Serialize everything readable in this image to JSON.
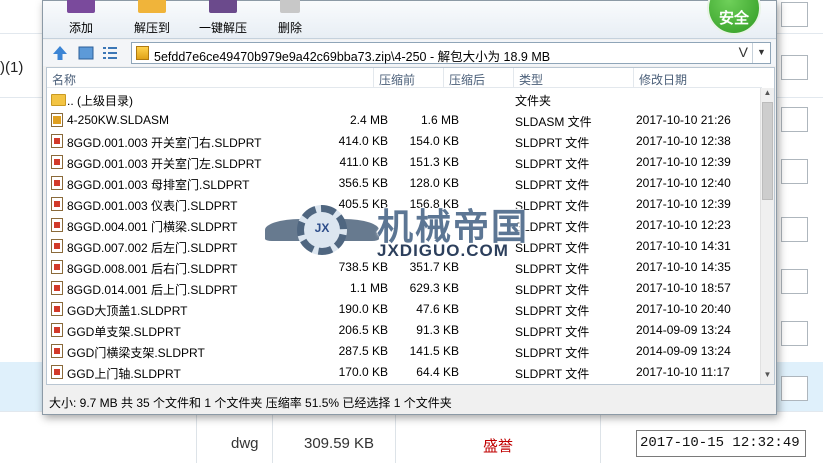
{
  "toolbar": {
    "buttons": [
      {
        "label": "添加",
        "color": "#7a4a9c"
      },
      {
        "label": "解压到",
        "color": "#f0b43a"
      },
      {
        "label": "一键解压",
        "color": "#6b4a8c"
      },
      {
        "label": "删除",
        "color": "#c8c8c8"
      }
    ],
    "badge": "安全"
  },
  "addressbar": {
    "path": "5efdd7e6ce49470b979e9a42c69bba73.zip\\4-250 - 解包大小为 18.9 MB",
    "history_glyph": "V"
  },
  "columns": {
    "name": "名称",
    "size": "压缩前",
    "packed": "压缩后",
    "type": "类型",
    "modified": "修改日期"
  },
  "files": [
    {
      "icon": "folder",
      "name": ".. (上级目录)",
      "size": "",
      "packed": "",
      "type": "文件夹",
      "modified": ""
    },
    {
      "icon": "asm",
      "name": "4-250KW.SLDASM",
      "size": "2.4 MB",
      "packed": "1.6 MB",
      "type": "SLDASM 文件",
      "modified": "2017-10-10 21:26"
    },
    {
      "icon": "doc",
      "name": "8GGD.001.003 开关室门右.SLDPRT",
      "size": "414.0 KB",
      "packed": "154.0 KB",
      "type": "SLDPRT 文件",
      "modified": "2017-10-10 12:38"
    },
    {
      "icon": "doc",
      "name": "8GGD.001.003 开关室门左.SLDPRT",
      "size": "411.0 KB",
      "packed": "151.3 KB",
      "type": "SLDPRT 文件",
      "modified": "2017-10-10 12:39"
    },
    {
      "icon": "doc",
      "name": "8GGD.001.003 母排室门.SLDPRT",
      "size": "356.5 KB",
      "packed": "128.0 KB",
      "type": "SLDPRT 文件",
      "modified": "2017-10-10 12:40"
    },
    {
      "icon": "doc",
      "name": "8GGD.001.003 仪表门.SLDPRT",
      "size": "405.5 KB",
      "packed": "156.8 KB",
      "type": "SLDPRT 文件",
      "modified": "2017-10-10 12:39"
    },
    {
      "icon": "doc",
      "name": "8GGD.004.001 门横梁.SLDPRT",
      "size": "",
      "packed": "",
      "type": "SLDPRT 文件",
      "modified": "2017-10-10 12:23"
    },
    {
      "icon": "doc",
      "name": "8GGD.007.002 后左门.SLDPRT",
      "size": "",
      "packed": "",
      "type": "SLDPRT 文件",
      "modified": "2017-10-10 14:31"
    },
    {
      "icon": "doc",
      "name": "8GGD.008.001 后右门.SLDPRT",
      "size": "738.5 KB",
      "packed": "351.7 KB",
      "type": "SLDPRT 文件",
      "modified": "2017-10-10 14:35"
    },
    {
      "icon": "doc",
      "name": "8GGD.014.001 后上门.SLDPRT",
      "size": "1.1 MB",
      "packed": "629.3 KB",
      "type": "SLDPRT 文件",
      "modified": "2017-10-10 18:57"
    },
    {
      "icon": "doc",
      "name": "GGD大顶盖1.SLDPRT",
      "size": "190.0 KB",
      "packed": "47.6 KB",
      "type": "SLDPRT 文件",
      "modified": "2017-10-10 20:40"
    },
    {
      "icon": "doc",
      "name": "GGD单支架.SLDPRT",
      "size": "206.5 KB",
      "packed": "91.3 KB",
      "type": "SLDPRT 文件",
      "modified": "2014-09-09 13:24"
    },
    {
      "icon": "doc",
      "name": "GGD门横梁支架.SLDPRT",
      "size": "287.5 KB",
      "packed": "141.5 KB",
      "type": "SLDPRT 文件",
      "modified": "2014-09-09 13:24"
    },
    {
      "icon": "doc",
      "name": "GGD上门轴.SLDPRT",
      "size": "170.0 KB",
      "packed": "64.4 KB",
      "type": "SLDPRT 文件",
      "modified": "2017-10-10 11:17"
    }
  ],
  "status": "大小: 9.7 MB 共 35 个文件和 1 个文件夹 压缩率 51.5% 已经选择 1 个文件夹",
  "watermark": {
    "emblem": "JX",
    "title": "机械帝国",
    "site": "JXDIGUO.COM"
  },
  "background": {
    "left_text": ")(1)",
    "row_ext": "dwg",
    "row_size": "309.59 KB",
    "row_user": "盛誉",
    "row_date": "2017-10-15 12:32:49",
    "highlight_color": "#dff0fb",
    "user_color": "#c00000"
  }
}
